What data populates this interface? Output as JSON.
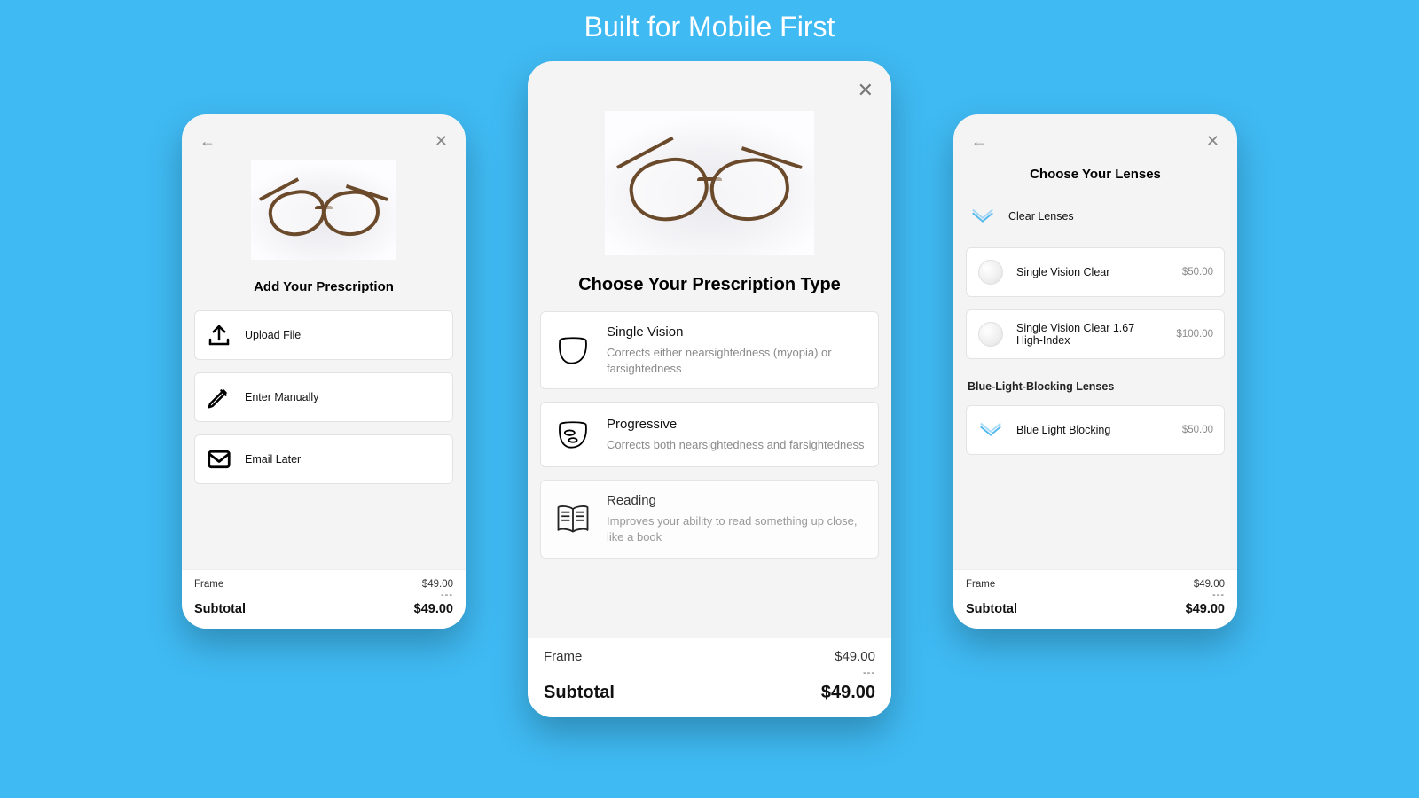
{
  "headline": "Built for Mobile First",
  "left": {
    "title": "Add Your Prescription",
    "options": [
      {
        "label": "Upload File"
      },
      {
        "label": "Enter Manually"
      },
      {
        "label": "Email Later"
      }
    ],
    "frame_label": "Frame",
    "frame_price": "$49.00",
    "dashes": "---",
    "subtotal_label": "Subtotal",
    "subtotal_price": "$49.00"
  },
  "center": {
    "title": "Choose Your Prescription Type",
    "options": [
      {
        "title": "Single Vision",
        "desc": "Corrects either nearsightedness (myopia) or farsightedness"
      },
      {
        "title": "Progressive",
        "desc": "Corrects both nearsightedness and farsightedness"
      },
      {
        "title": "Reading",
        "desc": "Improves your ability to read something up close, like a book"
      }
    ],
    "frame_label": "Frame",
    "frame_price": "$49.00",
    "dashes": "---",
    "subtotal_label": "Subtotal",
    "subtotal_price": "$49.00"
  },
  "right": {
    "title": "Choose Your Lenses",
    "group1_label": "Clear Lenses",
    "group1": [
      {
        "title": "Single Vision Clear",
        "price": "$50.00"
      },
      {
        "title": "Single Vision Clear 1.67 High-Index",
        "price": "$100.00"
      }
    ],
    "group2_heading": "Blue-Light-Blocking Lenses",
    "group2": [
      {
        "title": "Blue Light Blocking",
        "price": "$50.00"
      }
    ],
    "frame_label": "Frame",
    "frame_price": "$49.00",
    "dashes": "---",
    "subtotal_label": "Subtotal",
    "subtotal_price": "$49.00"
  }
}
